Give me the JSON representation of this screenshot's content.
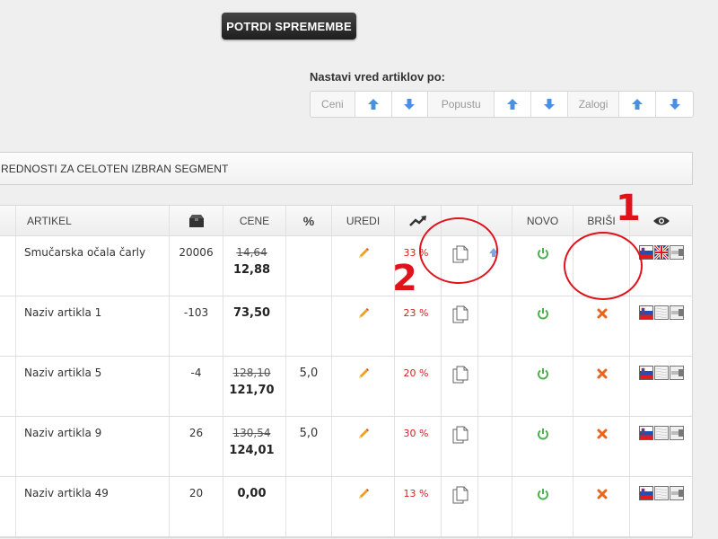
{
  "toolbar": {
    "confirm_label": "POTRDI SPREMEMBE"
  },
  "sorter": {
    "label": "Nastavi vred artiklov po:",
    "groups": [
      {
        "label": "Ceni"
      },
      {
        "label": "Popustu"
      },
      {
        "label": "Zalogi"
      }
    ]
  },
  "segment_bar": {
    "label": "REDNOSTI ZA CELOTEN IZBRAN SEGMENT"
  },
  "table": {
    "headers": {
      "name": "ARTIKEL",
      "stock_icon": "box-icon",
      "price": "CENE",
      "pct": "%",
      "edit": "UREDI",
      "trend_icon": "trend-up-icon",
      "new": "NOVO",
      "delete": "BRIŠI",
      "visibility_icon": "eye-icon"
    },
    "rows": [
      {
        "name": "Smučarska očala čarly",
        "stock": "20006",
        "price_old": "14,64",
        "price_new": "12,88",
        "pct": "",
        "trend": "33 %",
        "has_extra": true,
        "has_delete": false,
        "flags": [
          "si",
          "uk",
          "off"
        ]
      },
      {
        "name": "Naziv artikla 1",
        "stock": "-103",
        "price_old": "",
        "price_new": "73,50",
        "pct": "",
        "trend": "23 %",
        "has_extra": false,
        "has_delete": true,
        "flags": [
          "si",
          "blank",
          "off"
        ]
      },
      {
        "name": "Naziv artikla 5",
        "stock": "-4",
        "price_old": "128,10",
        "price_new": "121,70",
        "pct": "5,0",
        "trend": "20 %",
        "has_extra": false,
        "has_delete": true,
        "flags": [
          "si",
          "blank",
          "off"
        ]
      },
      {
        "name": "Naziv artikla 9",
        "stock": "26",
        "price_old": "130,54",
        "price_new": "124,01",
        "pct": "5,0",
        "trend": "30 %",
        "has_extra": false,
        "has_delete": true,
        "flags": [
          "si",
          "blank",
          "off"
        ]
      },
      {
        "name": "Naziv artikla 49",
        "stock": "20",
        "price_old": "",
        "price_new": "0,00",
        "pct": "",
        "trend": "13 %",
        "has_extra": false,
        "has_delete": true,
        "flags": [
          "si",
          "blank",
          "off"
        ]
      }
    ]
  },
  "annotations": {
    "one": "1",
    "two": "2",
    "color": "#e0121c"
  },
  "colors": {
    "arrow": "#4a90e2",
    "power": "#4caf50",
    "delete": "#e6661e",
    "trend": "#d21f1f"
  }
}
